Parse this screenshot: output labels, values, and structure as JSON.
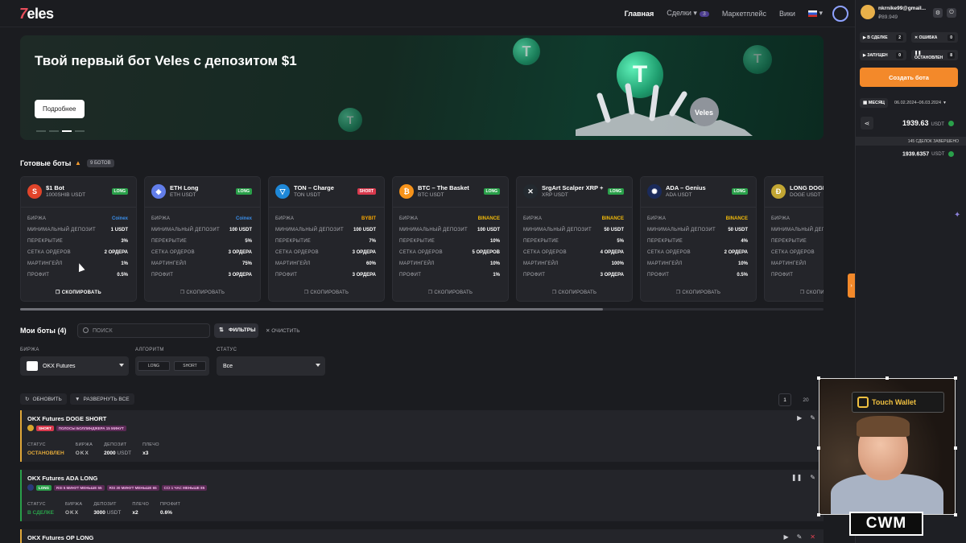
{
  "header": {
    "logo_seven": "7",
    "logo_text": "eles",
    "nav": {
      "home": "Главная",
      "deals": "Сделки",
      "deals_badge": "3",
      "market": "Маркетплейс",
      "wiki": "Вики"
    }
  },
  "banner": {
    "title": "Твой первый бот Veles с депозитом $1",
    "button": "Подробнее",
    "coin_symbol": "T",
    "robot_brand": "Veles"
  },
  "ready_bots": {
    "title": "Готовые боты",
    "count": "9 БОТОВ",
    "labels": {
      "exchange": "БИРЖА",
      "min_deposit": "МИНИМАЛЬНЫЙ ДЕПОЗИТ",
      "overlap": "ПЕРЕКРЫТИЕ",
      "grid": "СЕТКА ОРДЕРОВ",
      "martingale": "МАРТИНГЕЙЛ",
      "profit": "ПРОФИТ",
      "copy": "СКОПИРОВАТЬ"
    },
    "cards": [
      {
        "name": "$1 Bot",
        "pair": "1000SHIB  USDT",
        "dir": "LONG",
        "exchange": "Coinex",
        "min_deposit": "1 USDT",
        "overlap": "3%",
        "grid": "2 ОРДЕРА",
        "martingale": "1%",
        "profit": "0.5%",
        "icon": "S",
        "icon_color": "#e0442a"
      },
      {
        "name": "ETH Long",
        "pair": "ETH  USDT",
        "dir": "LONG",
        "exchange": "Coinex",
        "min_deposit": "100 USDT",
        "overlap": "5%",
        "grid": "3 ОРДЕРА",
        "martingale": "75%",
        "profit": "3 ОРДЕРА",
        "icon": "◆",
        "icon_color": "#627eea"
      },
      {
        "name": "TON – Charge",
        "pair": "TON  USDT",
        "dir": "SHORT",
        "exchange": "BYBIT",
        "min_deposit": "100 USDT",
        "overlap": "7%",
        "grid": "3 ОРДЕРА",
        "martingale": "60%",
        "profit": "3 ОРДЕРА",
        "icon": "▽",
        "icon_color": "#1e88d8"
      },
      {
        "name": "BTC – The Basket",
        "pair": "BTC  USDT",
        "dir": "LONG",
        "exchange": "BINANCE",
        "min_deposit": "100 USDT",
        "overlap": "10%",
        "grid": "5 ОРДЕРОВ",
        "martingale": "10%",
        "profit": "1%",
        "icon": "₿",
        "icon_color": "#f7931a"
      },
      {
        "name": "SrgArt Scalper XRP +",
        "pair": "XRP  USDT",
        "dir": "LONG",
        "exchange": "BINANCE",
        "min_deposit": "50 USDT",
        "overlap": "5%",
        "grid": "4 ОРДЕРА",
        "martingale": "100%",
        "profit": "3 ОРДЕРА",
        "icon": "✕",
        "icon_color": "#23292f"
      },
      {
        "name": "ADA – Genius",
        "pair": "ADA  USDT",
        "dir": "LONG",
        "exchange": "BINANCE",
        "min_deposit": "50 USDT",
        "overlap": "4%",
        "grid": "2 ОРДЕРА",
        "martingale": "10%",
        "profit": "0.5%",
        "icon": "✺",
        "icon_color": "#1a2a5a"
      },
      {
        "name": "LONG DOGE",
        "pair": "DOGE  USDT",
        "dir": "LONG",
        "exchange": "",
        "min_deposit": "",
        "overlap": "",
        "grid": "",
        "martingale": "",
        "profit": "",
        "icon": "Ð",
        "icon_color": "#c2a633"
      }
    ]
  },
  "my_bots": {
    "title": "Мои боты (4)",
    "search_placeholder": "ПОИСК",
    "filters": "ФИЛЬТРЫ",
    "clear": "ОЧИСТИТЬ",
    "exchange_label": "БИРЖА",
    "exchange_value": "OKX Futures",
    "algo_label": "АЛГОРИТМ",
    "algo_long": "LONG",
    "algo_short": "SHORT",
    "status_label": "СТАТУС",
    "status_value": "Все",
    "refresh": "ОБНОВИТЬ",
    "expand": "РАЗВЕРНУТЬ ВСЕ",
    "page": "1",
    "per_page": "20",
    "stat_labels": {
      "status": "СТАТУС",
      "exchange": "БИРЖА",
      "deposit": "ДЕПОЗИТ",
      "leverage": "ПЛЕЧО",
      "profit": "ПРОФИТ"
    },
    "list": [
      {
        "name": "OKX Futures DOGE SHORT",
        "dir": "SHORT",
        "tags": [
          "ПОЛОСЫ БОЛЛИНДЖЕРА 15 МИНУТ"
        ],
        "status": "ОСТАНОВЛЕН",
        "exchange": "OKX",
        "deposit": "2000",
        "deposit_cur": "USDT",
        "leverage": "x3",
        "profit": ""
      },
      {
        "name": "OKX Futures ADA LONG",
        "dir": "LONG",
        "tags": [
          "RSI 5 МИНУТ МЕНЬШЕ 55",
          "RSI 30 МИНУТ МЕНЬШЕ 65",
          "CCI 1 ЧАС МЕНЬШЕ 85"
        ],
        "status": "В СДЕЛКЕ",
        "exchange": "OKX",
        "deposit": "3000",
        "deposit_cur": "USDT",
        "leverage": "x2",
        "profit": "0.6%"
      },
      {
        "name": "OKX Futures OP LONG"
      }
    ]
  },
  "panel": {
    "user": "nkrnike99@gmail...",
    "balance": "₽89.949",
    "stats": [
      {
        "label": "В СДЕЛКЕ",
        "value": "2"
      },
      {
        "label": "ОШИБКА",
        "value": "0"
      },
      {
        "label": "ЗАПУЩЕН",
        "value": "0"
      },
      {
        "label": "ОСТАНОВЛЕН",
        "value": "8"
      }
    ],
    "create": "Создать бота",
    "period": "МЕСЯЦ",
    "range": "06.02.2024–06.03.2024",
    "total": "1939.63",
    "currency": "USDT",
    "deals": "145 СДЕЛОК ЗАВЕРШЕНО",
    "total2": "1939.6357"
  },
  "cam": {
    "sign": "Touch Wallet",
    "logo": "CWM"
  }
}
